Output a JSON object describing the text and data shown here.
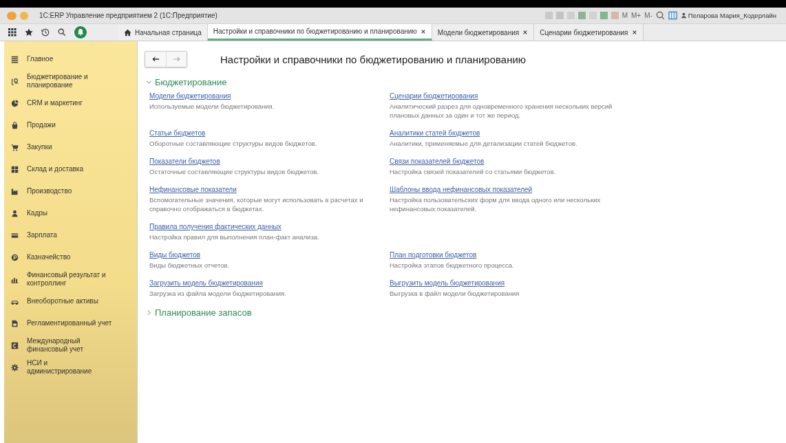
{
  "window": {
    "title": "1С:ERP Управление предприятием 2  (1С:Предприятие)",
    "toolbar_texts": [
      "M",
      "M+",
      "M-"
    ],
    "user": "Пеларова Мария_Кодерлайн"
  },
  "tabs": [
    {
      "label": "Начальная страница",
      "kind": "home",
      "selected": false
    },
    {
      "label": "Настройки и справочники по бюджетированию и планированию",
      "kind": "page",
      "selected": true
    },
    {
      "label": "Модели бюджетирования",
      "kind": "page",
      "selected": false
    },
    {
      "label": "Сценарии бюджетирования",
      "kind": "page",
      "selected": false
    }
  ],
  "sidebar": {
    "items": [
      {
        "label": "Главное"
      },
      {
        "label": "Бюджетирование и планирование"
      },
      {
        "label": "CRM и маркетинг"
      },
      {
        "label": "Продажи"
      },
      {
        "label": "Закупки"
      },
      {
        "label": "Склад и доставка"
      },
      {
        "label": "Производство"
      },
      {
        "label": "Кадры"
      },
      {
        "label": "Зарплата"
      },
      {
        "label": "Казначейство"
      },
      {
        "label": "Финансовый результат и контроллинг"
      },
      {
        "label": "Внеоборотные активы"
      },
      {
        "label": "Регламентированный учет"
      },
      {
        "label": "Международный финансовый учет"
      },
      {
        "label": "НСИ и администрирование"
      }
    ]
  },
  "page": {
    "title": "Настройки и справочники по бюджетированию и планированию",
    "sections": [
      {
        "title": "Бюджетирование",
        "expanded": true,
        "rows": [
          [
            {
              "link": "Модели бюджетирования",
              "description": "Используемые модели бюджетирования."
            },
            {
              "link": "Сценарии бюджетирования",
              "description": "Аналитический разрез для одновременного хранения нескольких версий плановых данных за один и тот же период."
            }
          ],
          [
            {
              "link": "Статьи бюджетов",
              "description": "Оборотные составляющие структуры видов бюджетов."
            },
            {
              "link": "Аналитики статей бюджетов",
              "description": "Аналитики, применяемые для детализации статей бюджетов."
            }
          ],
          [
            {
              "link": "Показатели бюджетов",
              "description": "Остаточные составляющие структуры видов бюджетов."
            },
            {
              "link": "Связи показателей бюджетов",
              "description": "Настройка связей показателей со статьями бюджетов."
            }
          ],
          [
            {
              "link": "Нефинансовые показатели",
              "description": "Вспомогательные значения, которые могут использовать в расчетах и справочно отображаться в бюджетах."
            },
            {
              "link": "Шаблоны ввода нефинансовых показателей",
              "description": "Настройка пользовательских форм для ввода одного или нескольких нефинансовых показателей."
            }
          ],
          [
            {
              "link": "Правила получения фактических данных",
              "description": "Настройка правил для выполнения план-факт анализа."
            }
          ],
          [
            {
              "link": "Виды бюджетов",
              "description": "Виды бюджетных отчетов."
            },
            {
              "link": "План подготовки бюджетов",
              "description": "Настройка этапов бюджетного процесса."
            }
          ],
          [
            {
              "link": "Загрузить модель бюджетирования",
              "description": "Загрузка из файла модели бюджетирования."
            },
            {
              "link": "Выгрузить модель бюджетирования",
              "description": "Выгрузка в файл модели бюджетирования"
            }
          ]
        ]
      },
      {
        "title": "Планирование запасов",
        "expanded": false
      }
    ]
  }
}
